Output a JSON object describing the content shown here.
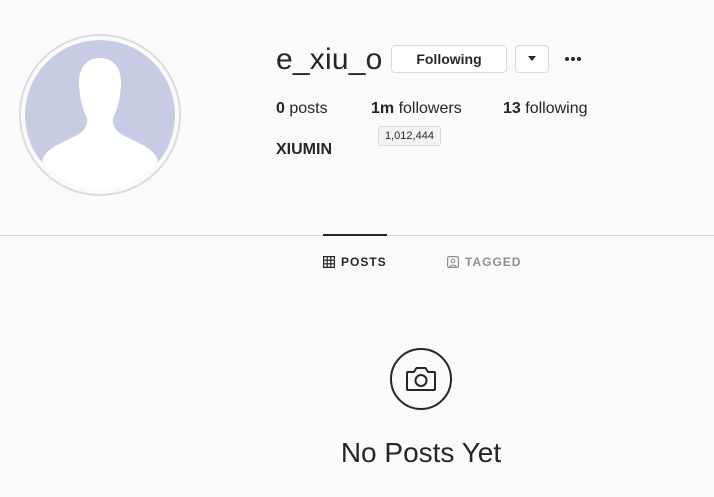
{
  "profile": {
    "username": "e_xiu_o",
    "full_name": "XIUMIN",
    "avatar_icon": "default-avatar-silhouette"
  },
  "actions": {
    "following_label": "Following",
    "dropdown_icon": "caret-down-icon",
    "more_icon": "more-options-icon"
  },
  "stats": {
    "posts_count": "0",
    "posts_label": "posts",
    "followers_count": "1m",
    "followers_label": "followers",
    "followers_tooltip": "1,012,444",
    "following_count": "13",
    "following_label": "following"
  },
  "tabs": [
    {
      "label": "POSTS",
      "icon": "grid-icon",
      "active": true
    },
    {
      "label": "TAGGED",
      "icon": "tagged-icon",
      "active": false
    }
  ],
  "empty_state": {
    "icon": "camera-icon",
    "title": "No Posts Yet"
  },
  "colors": {
    "background": "#fafafa",
    "text": "#262626",
    "muted": "#8e8e8e",
    "border": "#dbdbdb",
    "avatar_bg": "#c7cce4"
  }
}
